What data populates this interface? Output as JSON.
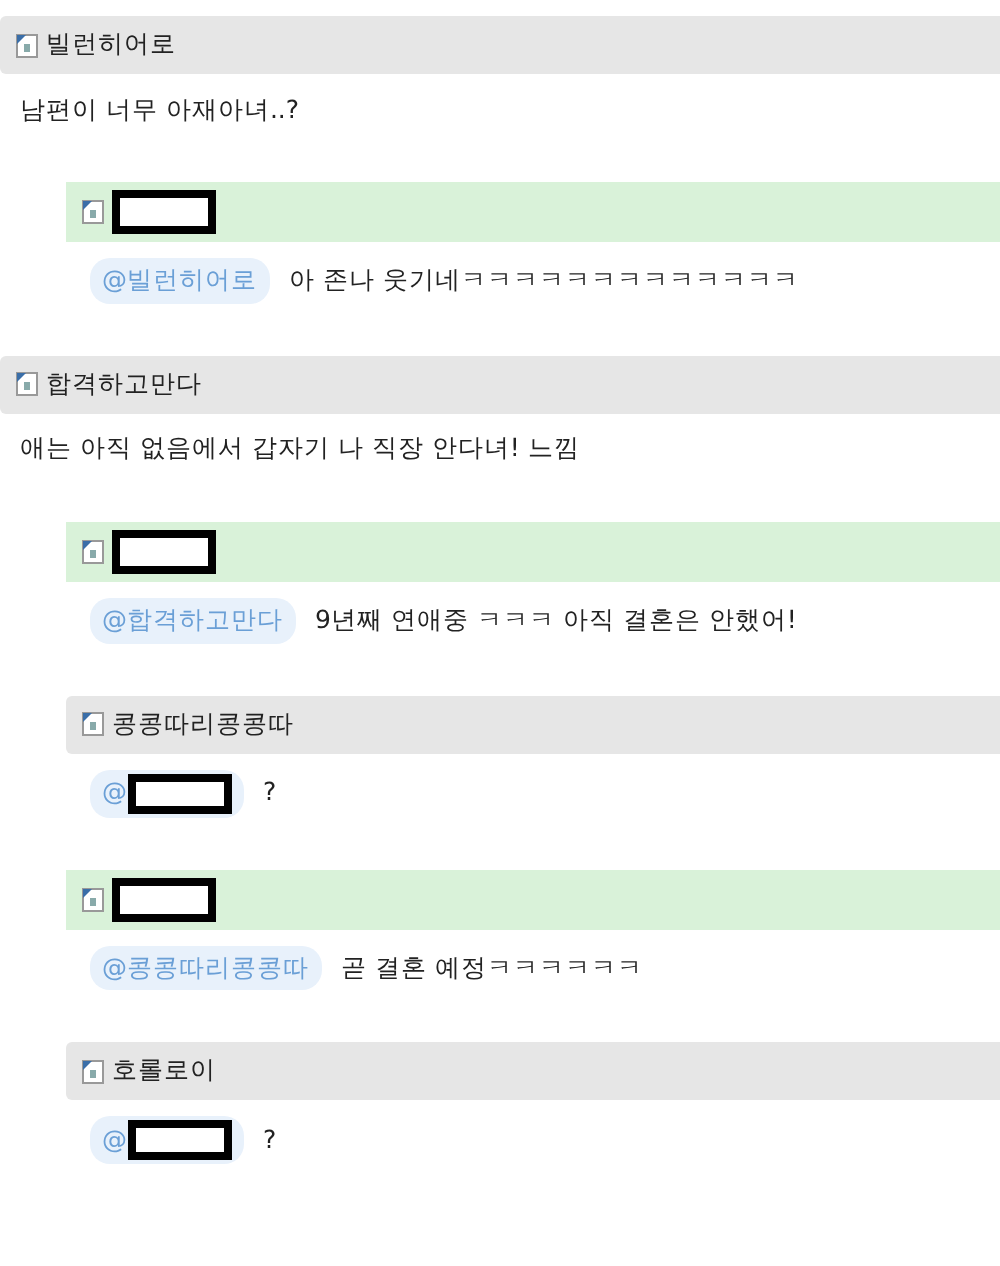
{
  "comments": [
    {
      "author": "빌런히어로",
      "author_redacted": false,
      "is_writer": false,
      "nested": false,
      "text": "남편이 너무 아재아녀..?"
    },
    {
      "author_redacted": true,
      "is_writer": true,
      "nested": true,
      "mention": "@빌런히어로",
      "mention_redacted": false,
      "text": "아 존나 웃기네ㅋㅋㅋㅋㅋㅋㅋㅋㅋㅋㅋㅋㅋ"
    },
    {
      "author": "합격하고만다",
      "author_redacted": false,
      "is_writer": false,
      "nested": false,
      "text": "애는 아직 없음에서 갑자기 나 직장 안다녀! 느낌"
    },
    {
      "author_redacted": true,
      "is_writer": true,
      "nested": true,
      "mention": "@합격하고만다",
      "mention_redacted": false,
      "text": "9년째 연애중 ㅋㅋㅋ 아직 결혼은 안했어!"
    },
    {
      "author": "콩콩따리콩콩따",
      "author_redacted": false,
      "is_writer": false,
      "nested": true,
      "mention": "@",
      "mention_redacted": true,
      "text": "?"
    },
    {
      "author_redacted": true,
      "is_writer": true,
      "nested": true,
      "mention": "@콩콩따리콩콩따",
      "mention_redacted": false,
      "text": "곧 결혼 예정ㅋㅋㅋㅋㅋㅋ"
    },
    {
      "author": "호롤로이",
      "author_redacted": false,
      "is_writer": false,
      "nested": true,
      "mention": "@",
      "mention_redacted": true,
      "text": "?"
    }
  ]
}
